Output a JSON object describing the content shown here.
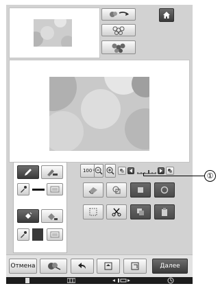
{
  "colors": {
    "accent_dark": "#3a3a3a",
    "line_color": "#111111",
    "fill_color": "#3a3a3a"
  },
  "icons": {
    "home": "home-icon",
    "scan": "scanner-icon",
    "pen": "pen-icon",
    "bucket": "paint-bucket-icon",
    "eyedropper": "eyedropper-icon",
    "eraser": "eraser-icon",
    "cut": "scissors-icon",
    "undo": "undo-icon"
  },
  "zoom": {
    "level_label": "100",
    "unit": "%"
  },
  "footer": {
    "cancel_label": "Отмена",
    "next_label": "Далее"
  },
  "callout": {
    "number": "①"
  }
}
